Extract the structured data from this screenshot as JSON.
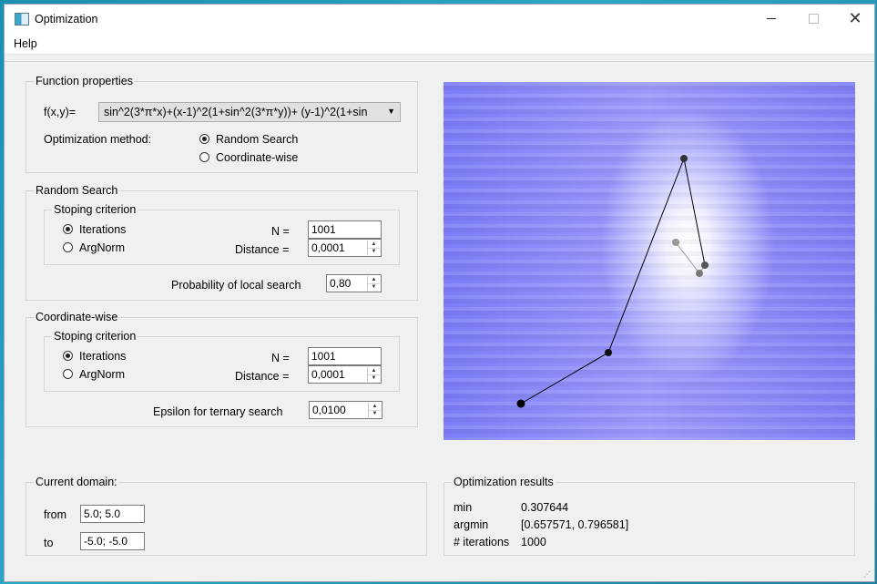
{
  "window": {
    "title": "Optimization"
  },
  "menu": {
    "help": "Help"
  },
  "function_properties": {
    "title": "Function properties",
    "fx_label": "f(x,y)=",
    "function_value": "sin^2(3*π*x)+(x-1)^2(1+sin^2(3*π*y))+ (y-1)^2(1+sin",
    "method_label": "Optimization method:",
    "methods": [
      {
        "label": "Random Search",
        "selected": true
      },
      {
        "label": "Coordinate-wise",
        "selected": false
      }
    ]
  },
  "random_search": {
    "title": "Random Search",
    "stop_title": "Stoping criterion",
    "opt_iterations": "Iterations",
    "opt_argnorm": "ArgNorm",
    "selected": "Iterations",
    "n_label": "N =",
    "n_value": "1001",
    "distance_label": "Distance =",
    "distance_value": "0,0001",
    "prob_label": "Probability of local search",
    "prob_value": "0,80"
  },
  "coordinate_wise": {
    "title": "Coordinate-wise",
    "stop_title": "Stoping criterion",
    "opt_iterations": "Iterations",
    "opt_argnorm": "ArgNorm",
    "selected": "Iterations",
    "n_label": "N =",
    "n_value": "1001",
    "distance_label": "Distance =",
    "distance_value": "0,0001",
    "eps_label": "Epsilon for ternary search",
    "eps_value": "0,0100"
  },
  "domain": {
    "title": "Current domain:",
    "from_label": "from",
    "from_value": "5.0; 5.0",
    "to_label": "to",
    "to_value": "-5.0; -5.0"
  },
  "results": {
    "title": "Optimization results",
    "min_label": "min",
    "min_value": "0.307644",
    "argmin_label": "argmin",
    "argmin_value": "[0.657571, 0.796581]",
    "iterations_label": "# iterations",
    "iterations_value": "1000"
  },
  "plot": {
    "path_colors": [
      "#000000",
      "#111111",
      "#333333",
      "#555555",
      "#777777",
      "#999999"
    ],
    "line_dark": "#000000",
    "line_light": "#9a9a9a"
  }
}
